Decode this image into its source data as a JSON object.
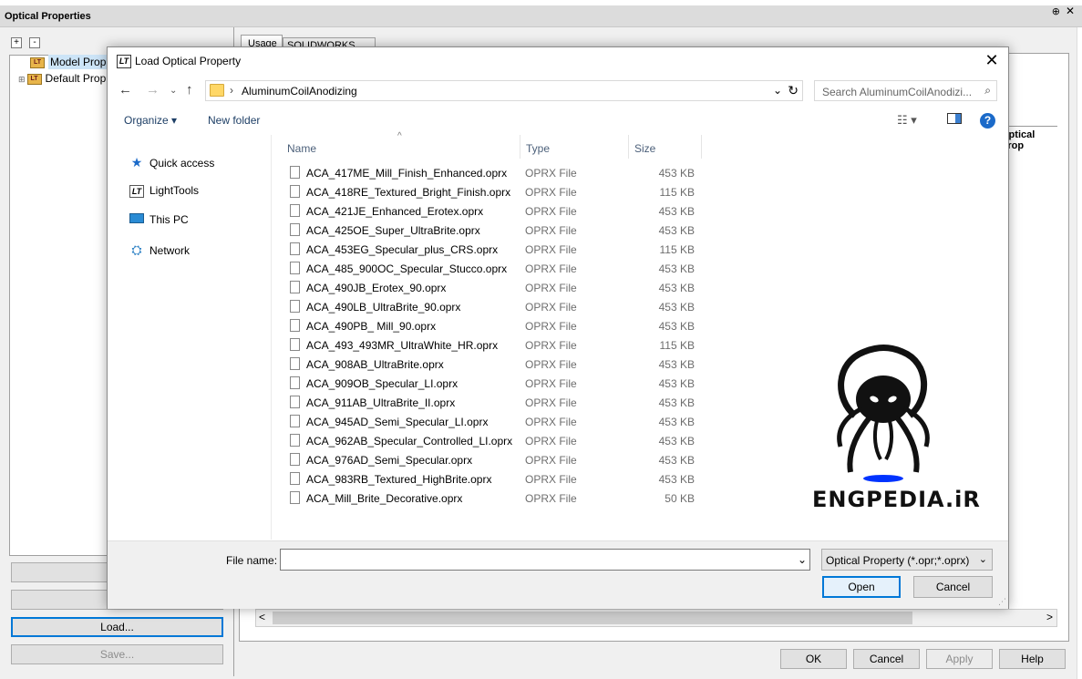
{
  "panel": {
    "title": "Optical Properties",
    "pin": "⊕",
    "close": "✕"
  },
  "tree": {
    "expand_btn": "+",
    "collapse_btn": "-",
    "items": [
      {
        "label": "Model Prop"
      },
      {
        "label": "Default Prop"
      }
    ]
  },
  "left_buttons": {
    "load": "Load...",
    "save": "Save..."
  },
  "tabs": {
    "usage": "Usage",
    "solidworks": "SOLIDWORKS Link"
  },
  "table_header": "Optical Prop",
  "bottom_buttons": {
    "ok": "OK",
    "cancel": "Cancel",
    "apply": "Apply",
    "help": "Help"
  },
  "dialog": {
    "title": "Load Optical Property",
    "title_icon": "LT",
    "close": "✕",
    "address_path": "AluminumCoilAnodizing",
    "search_placeholder": "Search AluminumCoilAnodizi...",
    "toolbar": {
      "organize": "Organize ▾",
      "new_folder": "New folder",
      "help": "?"
    },
    "nav": [
      {
        "label": "Quick access",
        "icon": "★"
      },
      {
        "label": "LightTools",
        "icon": "LT"
      },
      {
        "label": "This PC",
        "icon": ""
      },
      {
        "label": "Network",
        "icon": "⛭"
      }
    ],
    "columns": {
      "name": "Name",
      "type": "Type",
      "size": "Size"
    },
    "files": [
      {
        "name": "ACA_417ME_Mill_Finish_Enhanced.oprx",
        "type": "OPRX File",
        "size": "453 KB"
      },
      {
        "name": "ACA_418RE_Textured_Bright_Finish.oprx",
        "type": "OPRX File",
        "size": "115 KB"
      },
      {
        "name": "ACA_421JE_Enhanced_Erotex.oprx",
        "type": "OPRX File",
        "size": "453 KB"
      },
      {
        "name": "ACA_425OE_Super_UltraBrite.oprx",
        "type": "OPRX File",
        "size": "453 KB"
      },
      {
        "name": "ACA_453EG_Specular_plus_CRS.oprx",
        "type": "OPRX File",
        "size": "115 KB"
      },
      {
        "name": "ACA_485_900OC_Specular_Stucco.oprx",
        "type": "OPRX File",
        "size": "453 KB"
      },
      {
        "name": "ACA_490JB_Erotex_90.oprx",
        "type": "OPRX File",
        "size": "453 KB"
      },
      {
        "name": "ACA_490LB_UltraBrite_90.oprx",
        "type": "OPRX File",
        "size": "453 KB"
      },
      {
        "name": "ACA_490PB_ Mill_90.oprx",
        "type": "OPRX File",
        "size": "453 KB"
      },
      {
        "name": "ACA_493_493MR_UltraWhite_HR.oprx",
        "type": "OPRX File",
        "size": "115 KB"
      },
      {
        "name": "ACA_908AB_UltraBrite.oprx",
        "type": "OPRX File",
        "size": "453 KB"
      },
      {
        "name": "ACA_909OB_Specular_LI.oprx",
        "type": "OPRX File",
        "size": "453 KB"
      },
      {
        "name": "ACA_911AB_UltraBrite_II.oprx",
        "type": "OPRX File",
        "size": "453 KB"
      },
      {
        "name": "ACA_945AD_Semi_Specular_LI.oprx",
        "type": "OPRX File",
        "size": "453 KB"
      },
      {
        "name": "ACA_962AB_Specular_Controlled_LI.oprx",
        "type": "OPRX File",
        "size": "453 KB"
      },
      {
        "name": "ACA_976AD_Semi_Specular.oprx",
        "type": "OPRX File",
        "size": "453 KB"
      },
      {
        "name": "ACA_983RB_Textured_HighBrite.oprx",
        "type": "OPRX File",
        "size": "453 KB"
      },
      {
        "name": "ACA_Mill_Brite_Decorative.oprx",
        "type": "OPRX File",
        "size": "50 KB"
      }
    ],
    "file_name_label": "File name:",
    "file_name_value": "",
    "file_type": "Optical Property (*.opr;*.oprx)",
    "open": "Open",
    "cancel": "Cancel"
  },
  "watermark": {
    "text": "ENGPEDIA.iR"
  },
  "colors": {
    "accent": "#0078d7",
    "selection": "#cce4f7",
    "folder": "#ffd766"
  }
}
